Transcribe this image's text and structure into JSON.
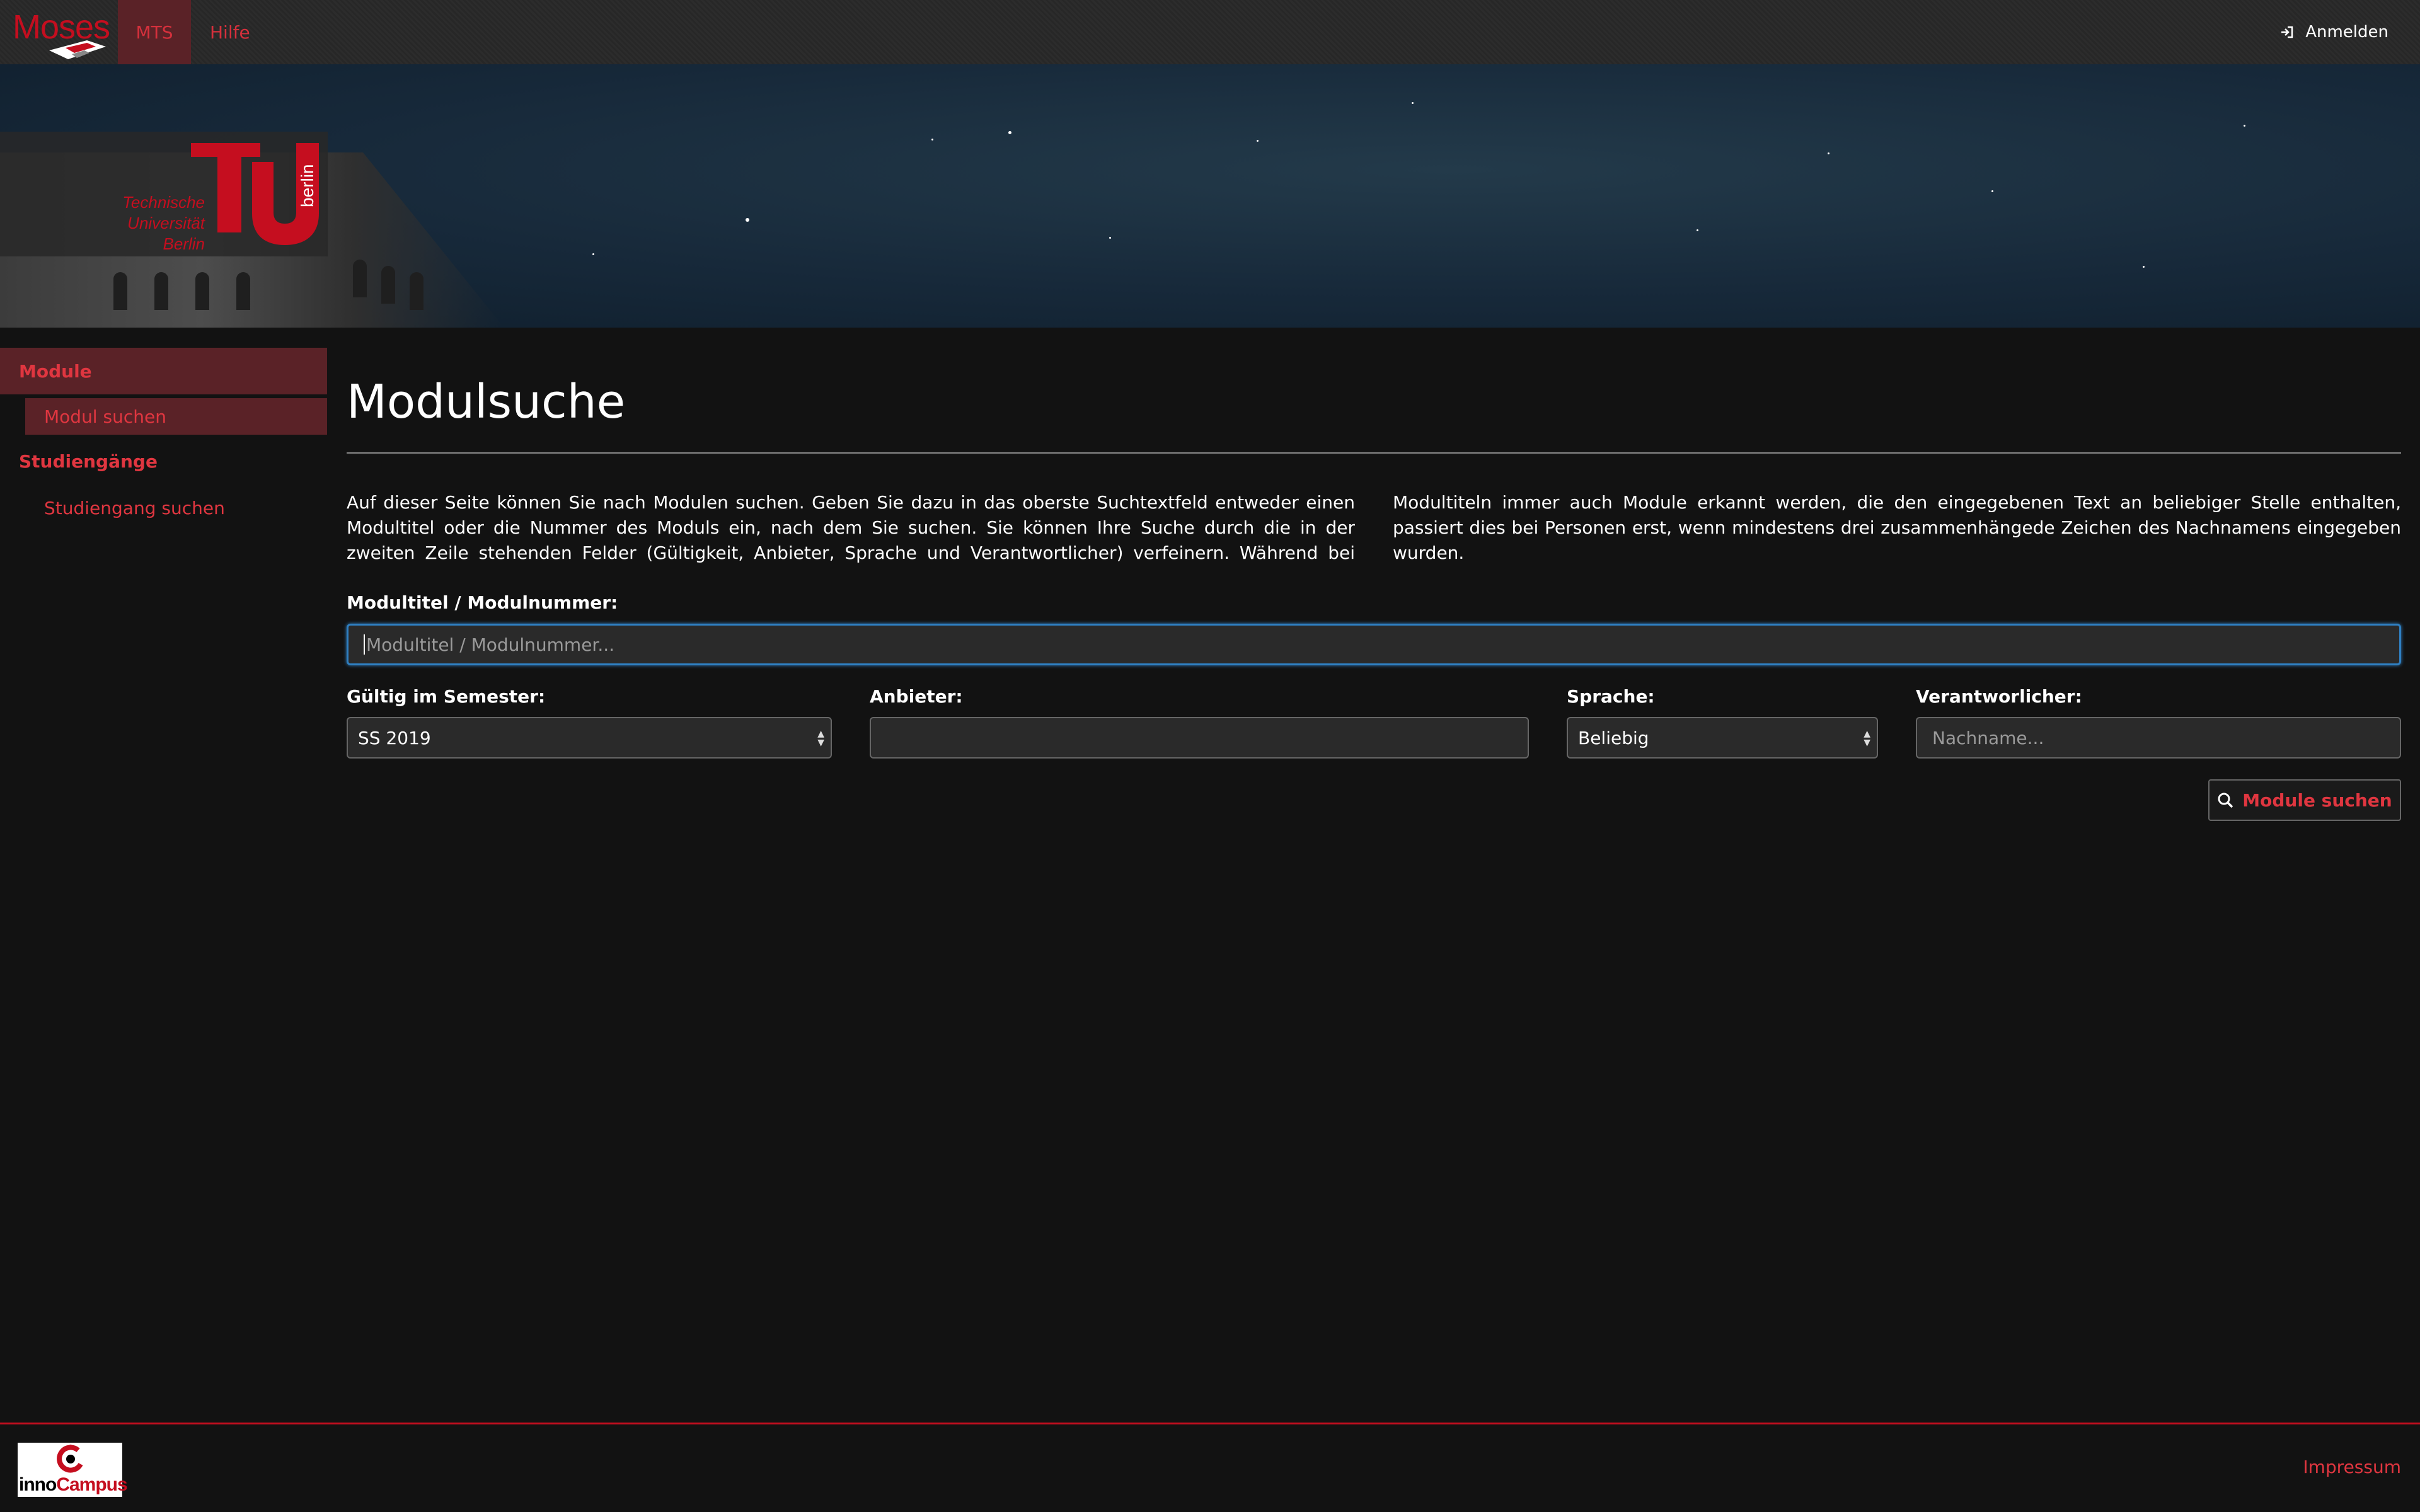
{
  "navbar": {
    "brand": "Moses",
    "items": [
      {
        "label": "MTS",
        "active": true
      },
      {
        "label": "Hilfe",
        "active": false
      }
    ],
    "login_label": "Anmelden",
    "login_icon": "sign-in-icon"
  },
  "banner": {
    "university_text": [
      "Technische",
      "Universität",
      "Berlin"
    ],
    "logo_word": "berlin"
  },
  "sidebar": {
    "sections": [
      {
        "label": "Module",
        "items": [
          {
            "label": "Modul suchen",
            "active": true
          }
        ]
      },
      {
        "label": "Studiengänge",
        "items": [
          {
            "label": "Studiengang suchen",
            "active": false
          }
        ]
      }
    ]
  },
  "main": {
    "title": "Modulsuche",
    "intro": "Auf dieser Seite können Sie nach Modulen suchen. Geben Sie dazu in das oberste Suchtextfeld entweder einen Modultitel oder die Nummer des Moduls ein, nach dem Sie suchen. Sie können Ihre Suche durch die in der zweiten Zeile stehenden Felder (Gültigkeit, Anbieter, Sprache und Verantwortlicher) verfeinern. Während bei Modultiteln immer auch Module erkannt werden, die den eingegebenen Text an beliebiger Stelle enthalten, passiert dies bei Personen erst, wenn mindestens drei zusammenhängede Zeichen des Nachnamens eingegeben wurden.",
    "search": {
      "label": "Modultitel / Modulnummer:",
      "placeholder": "Modultitel / Modulnummer...",
      "value": ""
    },
    "filters": {
      "semester": {
        "label": "Gültig im Semester:",
        "value": "SS 2019"
      },
      "anbieter": {
        "label": "Anbieter:",
        "value": ""
      },
      "sprache": {
        "label": "Sprache:",
        "value": "Beliebig"
      },
      "verantwortlicher": {
        "label": "Verantworlicher:",
        "placeholder": "Nachname...",
        "value": ""
      }
    },
    "submit_label": "Module suchen",
    "submit_icon": "search-icon"
  },
  "footer": {
    "partner_logo": [
      "inno",
      "Campus"
    ],
    "impressum": "Impressum"
  },
  "colors": {
    "accent": "#e03640",
    "brand_red": "#c50e1f",
    "active_bg": "#5a2227",
    "focus": "#2f7fc1"
  }
}
